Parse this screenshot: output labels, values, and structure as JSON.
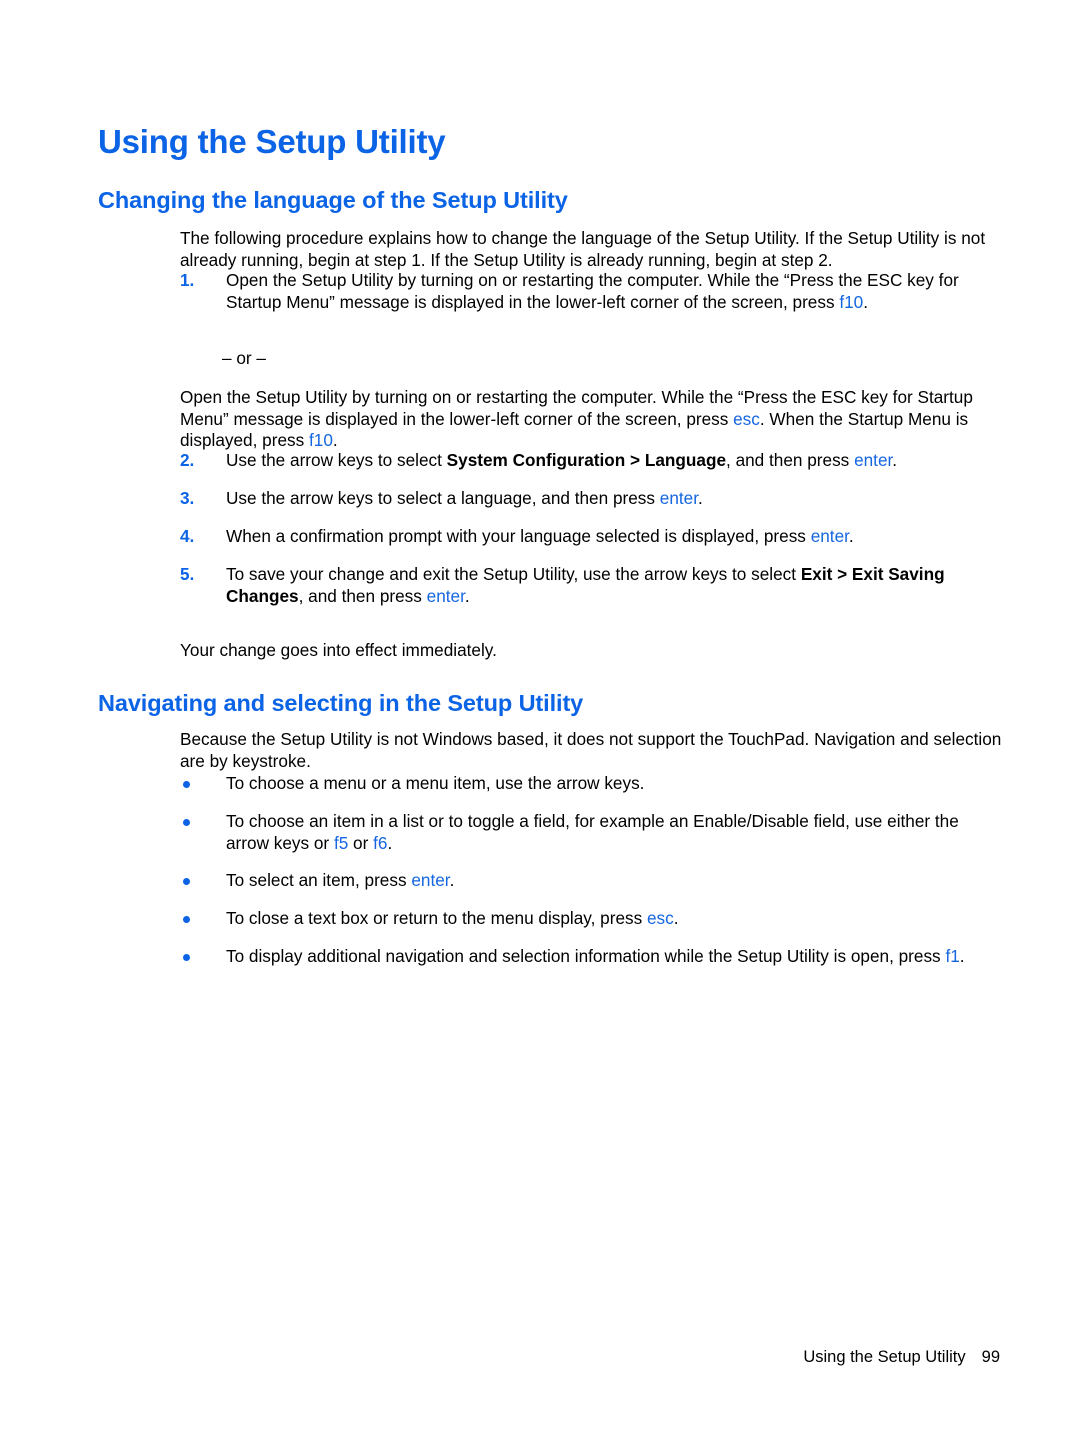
{
  "document": {
    "title": "Using the Setup Utility",
    "accent_color": "#0b63e5",
    "key_color": "#1566e0",
    "text_color": "#000000",
    "background_color": "#ffffff"
  },
  "sections": {
    "changing_language": {
      "heading": "Changing the language of the Setup Utility",
      "intro": "The following procedure explains how to change the language of the Setup Utility. If the Setup Utility is not already running, begin at step 1. If the Setup Utility is already running, begin at step 2.",
      "or_separator": "– or –",
      "alternate": {
        "part1": "Open the Setup Utility by turning on or restarting the computer. While the “Press the ESC key for Startup Menu” message is displayed in the lower-left corner of the screen, press ",
        "key1": "esc",
        "part2": ". When the Startup Menu is displayed, press ",
        "key2": "f10",
        "part3": "."
      },
      "steps": [
        {
          "number": "1.",
          "part1": "Open the Setup Utility by turning on or restarting the computer. While the “Press the ESC key for Startup Menu” message is displayed in the lower-left corner of the screen, press ",
          "key1": "f10",
          "part2": "."
        },
        {
          "number": "2.",
          "part1": "Use the arrow keys to select ",
          "bold1": "System Configuration > Language",
          "part2": ", and then press ",
          "key1": "enter",
          "part3": "."
        },
        {
          "number": "3.",
          "part1": "Use the arrow keys to select a language, and then press ",
          "key1": "enter",
          "part2": "."
        },
        {
          "number": "4.",
          "part1": "When a confirmation prompt with your language selected is displayed, press ",
          "key1": "enter",
          "part2": "."
        },
        {
          "number": "5.",
          "part1": "To save your change and exit the Setup Utility, use the arrow keys to select ",
          "bold1": "Exit > Exit Saving Changes",
          "part2": ", and then press ",
          "key1": "enter",
          "part3": "."
        }
      ],
      "closing": "Your change goes into effect immediately."
    },
    "navigating": {
      "heading": "Navigating and selecting in the Setup Utility",
      "intro": "Because the Setup Utility is not Windows based, it does not support the TouchPad. Navigation and selection are by keystroke.",
      "bullets": [
        {
          "part1": "To choose a menu or a menu item, use the arrow keys."
        },
        {
          "part1": "To choose an item in a list or to toggle a field, for example an Enable/Disable field, use either the arrow keys or ",
          "key1": "f5",
          "part2": " or ",
          "key2": "f6",
          "part3": "."
        },
        {
          "part1": "To select an item, press ",
          "key1": "enter",
          "part2": "."
        },
        {
          "part1": "To close a text box or return to the menu display, press ",
          "key1": "esc",
          "part2": "."
        },
        {
          "part1": "To display additional navigation and selection information while the Setup Utility is open, press ",
          "key1": "f1",
          "part2": "."
        }
      ]
    }
  },
  "footer": {
    "label": "Using the Setup Utility",
    "page_number": "99"
  }
}
